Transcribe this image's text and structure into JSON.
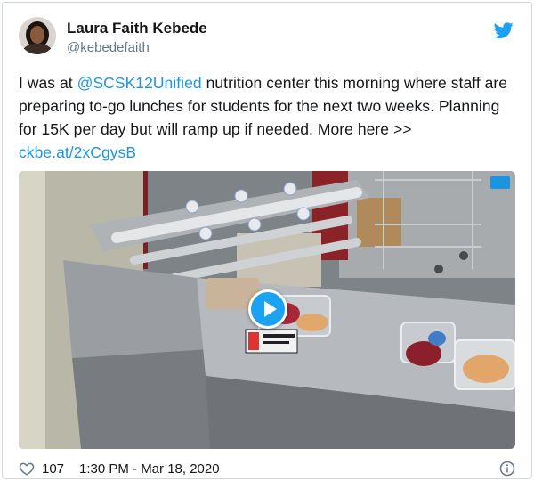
{
  "user": {
    "display_name": "Laura Faith Kebede",
    "handle": "@kebedefaith",
    "avatar_icon": "avatar-photo"
  },
  "tweet": {
    "text_before_mention": "I was at ",
    "mention": "@SCSK12Unified",
    "text_after_mention": " nutrition center this morning where staff are preparing to-go lunches for students for the next two weeks. Planning for 15K per day but will ramp up if needed. More here >> ",
    "link": "ckbe.at/2xCgysB"
  },
  "media": {
    "play_icon": "play-icon",
    "type": "video"
  },
  "footer": {
    "like_count": "107",
    "timestamp": "1:30 PM - Mar 18, 2020"
  },
  "colors": {
    "link": "#1b95e0",
    "twitter_blue": "#1da1f2",
    "secondary_text": "#657786"
  }
}
